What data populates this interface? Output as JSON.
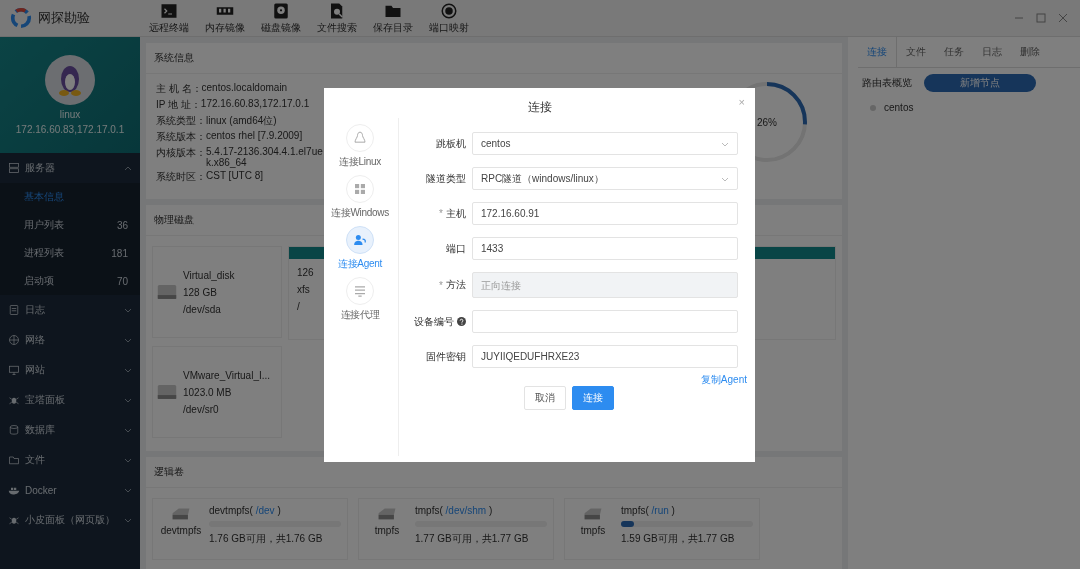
{
  "app": {
    "title": "网探勘验"
  },
  "toolbar": [
    {
      "label": "远程终端",
      "kind": "terminal"
    },
    {
      "label": "内存镜像",
      "kind": "memory"
    },
    {
      "label": "磁盘镜像",
      "kind": "disk"
    },
    {
      "label": "文件搜索",
      "kind": "search"
    },
    {
      "label": "保存目录",
      "kind": "folder"
    },
    {
      "label": "端口映射",
      "kind": "port"
    }
  ],
  "host": {
    "name": "linux",
    "ip": "172.16.60.83,172.17.0.1"
  },
  "menu": [
    {
      "label": "服务器",
      "kind": "server",
      "expanded": true,
      "children": [
        {
          "label": "基本信息",
          "selected": true
        },
        {
          "label": "用户列表",
          "count": "36",
          "selected": false
        },
        {
          "label": "进程列表",
          "count": "181",
          "selected": false
        },
        {
          "label": "启动项",
          "count": "70",
          "selected": false
        }
      ]
    },
    {
      "label": "日志",
      "kind": "log",
      "expanded": false
    },
    {
      "label": "网络",
      "kind": "network",
      "expanded": false
    },
    {
      "label": "网站",
      "kind": "website",
      "expanded": false
    },
    {
      "label": "宝塔面板",
      "kind": "panel",
      "expanded": false
    },
    {
      "label": "数据库",
      "kind": "database",
      "expanded": false
    },
    {
      "label": "文件",
      "kind": "folder",
      "expanded": false
    },
    {
      "label": "Docker",
      "kind": "docker",
      "expanded": false
    },
    {
      "label": "小皮面板（网页版）",
      "kind": "panel",
      "expanded": false
    }
  ],
  "system_info": {
    "title": "系统信息",
    "rows": [
      {
        "label": "主 机 名：",
        "value": "centos.localdomain"
      },
      {
        "label": "IP 地 址：",
        "value": "172.16.60.83,172.17.0.1"
      },
      {
        "label": "系统类型：",
        "value": "linux (amd64位)"
      },
      {
        "label": "系统版本：",
        "value": "centos rhel [7.9.2009]"
      },
      {
        "label": "内核版本：",
        "value": "5.4.17-2136.304.4.1.el7uek.x86_64"
      },
      {
        "label": "系统时区：",
        "value": "CST [UTC 8]"
      }
    ],
    "gauge": {
      "level": 0.26,
      "reading": "26%"
    }
  },
  "physical_disks": {
    "title": "物理磁盘",
    "disks": [
      {
        "name": "Virtual_disk",
        "size": "128 GB",
        "device": "/dev/sda"
      },
      {
        "name": "VMware_Virtual_I...",
        "size": "1023.0 MB",
        "device": "/dev/sr0"
      }
    ],
    "partition": {
      "lines": [
        "126",
        "xfs",
        "/"
      ]
    }
  },
  "logical_volumes": {
    "title": "逻辑卷",
    "volumes": [
      {
        "name": "devtmpfs(",
        "mount": "/dev",
        "suffix": ")",
        "label": "devtmpfs",
        "level": 0,
        "usage": "1.76 GB可用，共1.76 GB"
      },
      {
        "name": "tmpfs(",
        "mount": "/dev/shm",
        "suffix": ")",
        "label": "tmpfs",
        "level": 0,
        "usage": "1.77 GB可用，共1.77 GB"
      },
      {
        "name": "tmpfs(",
        "mount": "/run",
        "suffix": ")",
        "label": "tmpfs",
        "level": 0.1,
        "usage": "1.59 GB可用，共1.77 GB"
      }
    ]
  },
  "right_panel": {
    "tabs": [
      {
        "label": "连接",
        "selected": true
      },
      {
        "label": "文件",
        "selected": false
      },
      {
        "label": "任务",
        "selected": false
      },
      {
        "label": "日志",
        "selected": false
      },
      {
        "label": "删除",
        "selected": false
      }
    ],
    "route_label": "路由表概览",
    "add_button": "新增节点",
    "nodes": [
      {
        "name": "centos"
      }
    ]
  },
  "dialog": {
    "title": "连接",
    "close": "×",
    "modes": [
      {
        "label": "连接Linux",
        "kind": "linux",
        "selected": false
      },
      {
        "label": "连接Windows",
        "kind": "windows",
        "selected": false
      },
      {
        "label": "连接Agent",
        "kind": "agent",
        "selected": true
      },
      {
        "label": "连接代理",
        "kind": "proxy",
        "selected": false
      }
    ],
    "fields": [
      {
        "label": "跳板机",
        "kind": "select",
        "value": "centos"
      },
      {
        "label": "隧道类型",
        "kind": "select",
        "value": "RPC隧道（windows/linux）"
      },
      {
        "label": "主机",
        "mark": "*",
        "kind": "text",
        "value": "172.16.60.91"
      },
      {
        "label": "端口",
        "kind": "text",
        "value": "1433"
      },
      {
        "label": "方法",
        "mark": "*",
        "kind": "text",
        "disabled": true,
        "placeholder": "正向连接"
      },
      {
        "label": "设备编号",
        "help": true,
        "kind": "text"
      },
      {
        "label": "固件密钥",
        "kind": "text",
        "value": "JUYIIQEDUFHRXE23"
      }
    ],
    "link": "复制Agent",
    "buttons": [
      {
        "label": "取消",
        "kind": "secondary"
      },
      {
        "label": "连接",
        "kind": "primary"
      }
    ]
  }
}
